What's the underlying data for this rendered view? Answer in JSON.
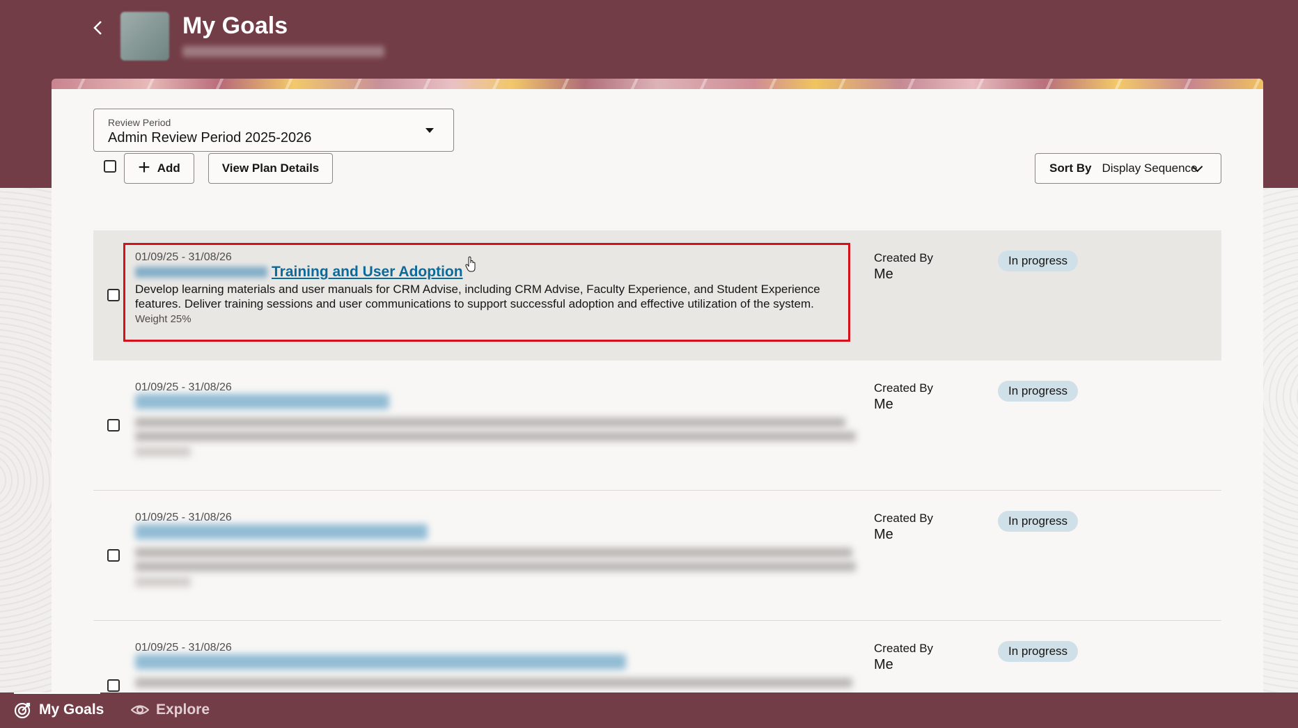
{
  "header": {
    "title": "My Goals"
  },
  "review_period": {
    "label": "Review Period",
    "value": "Admin Review Period 2025-2026"
  },
  "toolbar": {
    "add_label": "Add",
    "view_plan_label": "View Plan Details",
    "sort_prefix": "Sort By",
    "sort_value": "Display Sequence"
  },
  "goals": [
    {
      "dates": "01/09/25 - 31/08/26",
      "title": "Training and User Adoption",
      "description": "Develop learning materials and user manuals for CRM Advise, including CRM Advise, Faculty Experience, and Student Experience features. Deliver training sessions and user communications to support successful adoption and effective utilization of the system.",
      "weight": "Weight 25%",
      "created_by_label": "Created By",
      "created_by": "Me",
      "status": "In progress"
    },
    {
      "dates": "01/09/25 - 31/08/26",
      "created_by_label": "Created By",
      "created_by": "Me",
      "status": "In progress"
    },
    {
      "dates": "01/09/25 - 31/08/26",
      "created_by_label": "Created By",
      "created_by": "Me",
      "status": "In progress"
    },
    {
      "dates": "01/09/25 - 31/08/26",
      "created_by_label": "Created By",
      "created_by": "Me",
      "status": "In progress"
    }
  ],
  "bottom_nav": [
    {
      "label": "My Goals",
      "icon": "target-icon"
    },
    {
      "label": "Explore",
      "icon": "eye-icon"
    }
  ],
  "colors": {
    "brand": "#733d47",
    "link": "#0b6a99",
    "status_bg": "#cfe0e8",
    "highlight": "#d3121c"
  }
}
